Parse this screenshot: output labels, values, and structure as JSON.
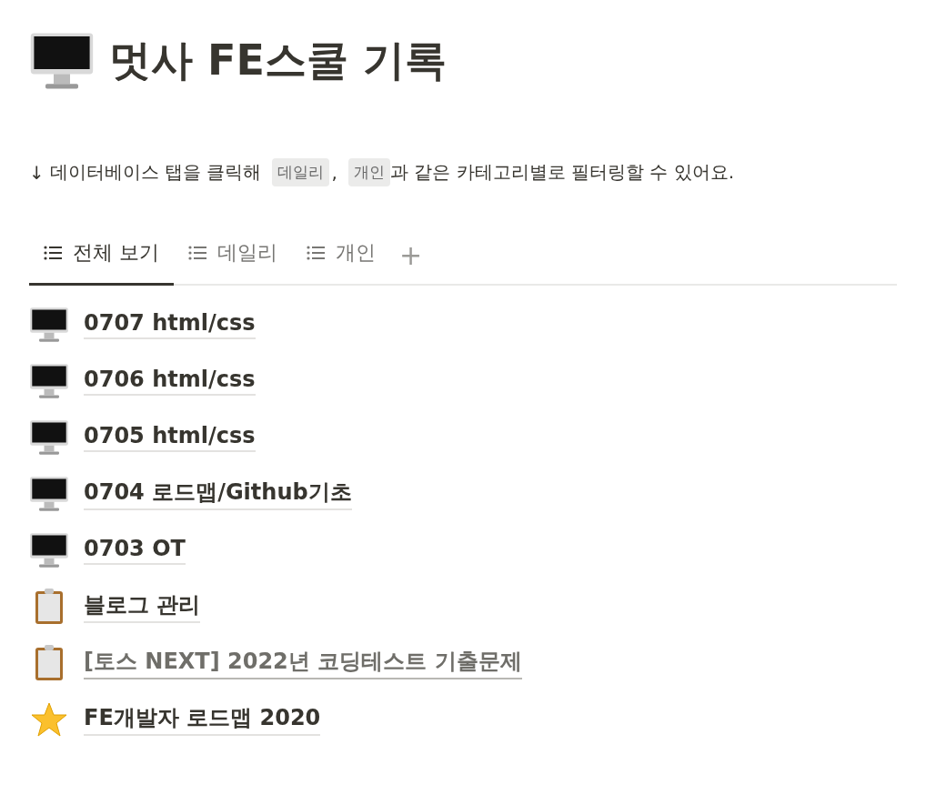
{
  "page": {
    "title": "멋사 FE스쿨 기록"
  },
  "intro": {
    "arrow": "↓",
    "before": "데이터베이스 탭을 클릭해",
    "chips": [
      "데일리",
      "개인"
    ],
    "separator": ",",
    "after": "과 같은 카테고리별로 필터링할 수 있어요."
  },
  "tabs": [
    {
      "label": "전체 보기",
      "selected": true
    },
    {
      "label": "데일리",
      "selected": false
    },
    {
      "label": "개인",
      "selected": false
    }
  ],
  "add_tab": "+",
  "items": [
    {
      "title": "0707 html/css",
      "kind": "computer",
      "muted": false
    },
    {
      "title": "0706 html/css",
      "kind": "computer",
      "muted": false
    },
    {
      "title": "0705 html/css",
      "kind": "computer",
      "muted": false
    },
    {
      "title": "0704 로드맵/Github기초",
      "kind": "computer",
      "muted": false
    },
    {
      "title": "0703 OT",
      "kind": "computer",
      "muted": false
    },
    {
      "title": "블로그 관리",
      "kind": "clipboard",
      "muted": false
    },
    {
      "title": "[토스 NEXT] 2022년 코딩테스트 기출문제",
      "kind": "clipboard",
      "muted": true
    },
    {
      "title": "FE개발자 로드맵 2020",
      "kind": "star",
      "muted": false
    }
  ]
}
